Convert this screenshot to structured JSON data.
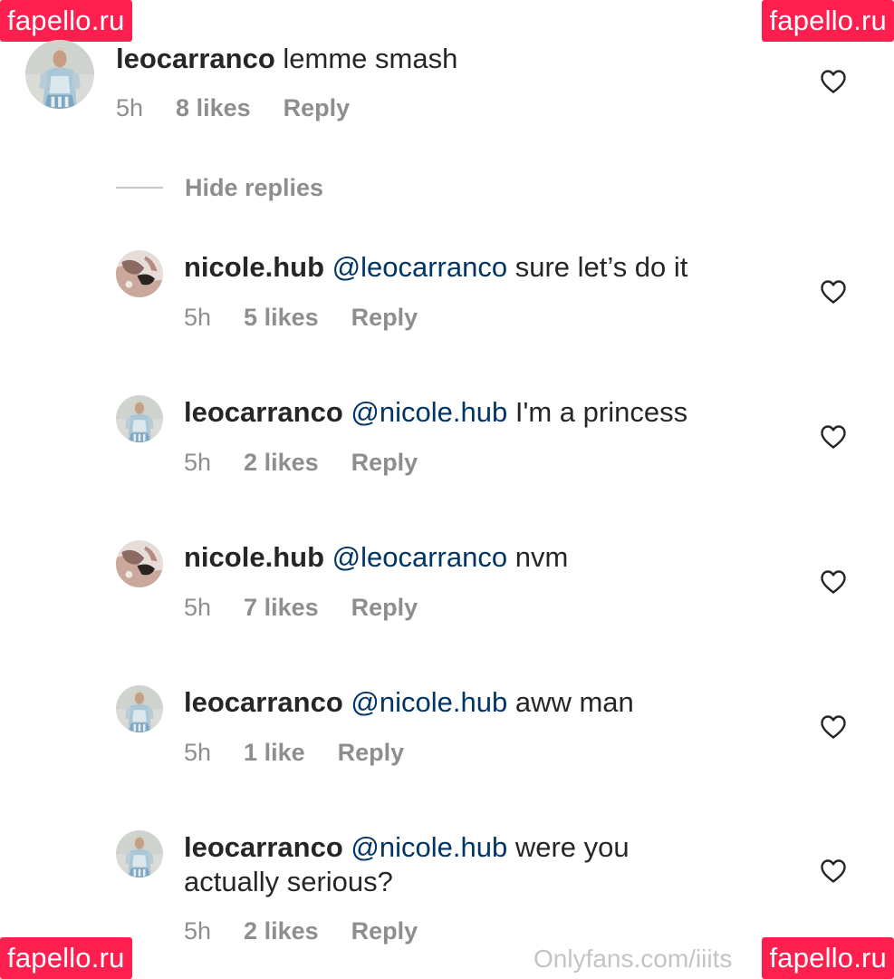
{
  "watermarks": {
    "site": "fapello.ru",
    "source": "Onlyfans.com/iiits"
  },
  "colors": {
    "watermark_bg": "#ff1f4f",
    "username": "#262626",
    "mention": "#003569",
    "meta": "#8e8e8e"
  },
  "thread": {
    "parent": {
      "username": "leocarranco",
      "text": "lemme smash",
      "time": "5h",
      "likes": "8 likes",
      "reply": "Reply",
      "avatar_icon": "avatar-prince-costume"
    },
    "hide_replies": "Hide replies",
    "replies": [
      {
        "username": "nicole.hub",
        "mention": "@leocarranco",
        "text": "sure let’s do it",
        "time": "5h",
        "likes": "5 likes",
        "reply": "Reply",
        "avatar_icon": "avatar-nicole"
      },
      {
        "username": "leocarranco",
        "mention": "@nicole.hub",
        "text": "I'm a princess",
        "time": "5h",
        "likes": "2 likes",
        "reply": "Reply",
        "avatar_icon": "avatar-prince-costume"
      },
      {
        "username": "nicole.hub",
        "mention": "@leocarranco",
        "text": "nvm",
        "time": "5h",
        "likes": "7 likes",
        "reply": "Reply",
        "avatar_icon": "avatar-nicole"
      },
      {
        "username": "leocarranco",
        "mention": "@nicole.hub",
        "text": "aww man",
        "time": "5h",
        "likes": "1 like",
        "reply": "Reply",
        "avatar_icon": "avatar-prince-costume"
      },
      {
        "username": "leocarranco",
        "mention": "@nicole.hub",
        "text": "were you actually serious?",
        "time": "5h",
        "likes": "2 likes",
        "reply": "Reply",
        "avatar_icon": "avatar-prince-costume"
      }
    ]
  }
}
